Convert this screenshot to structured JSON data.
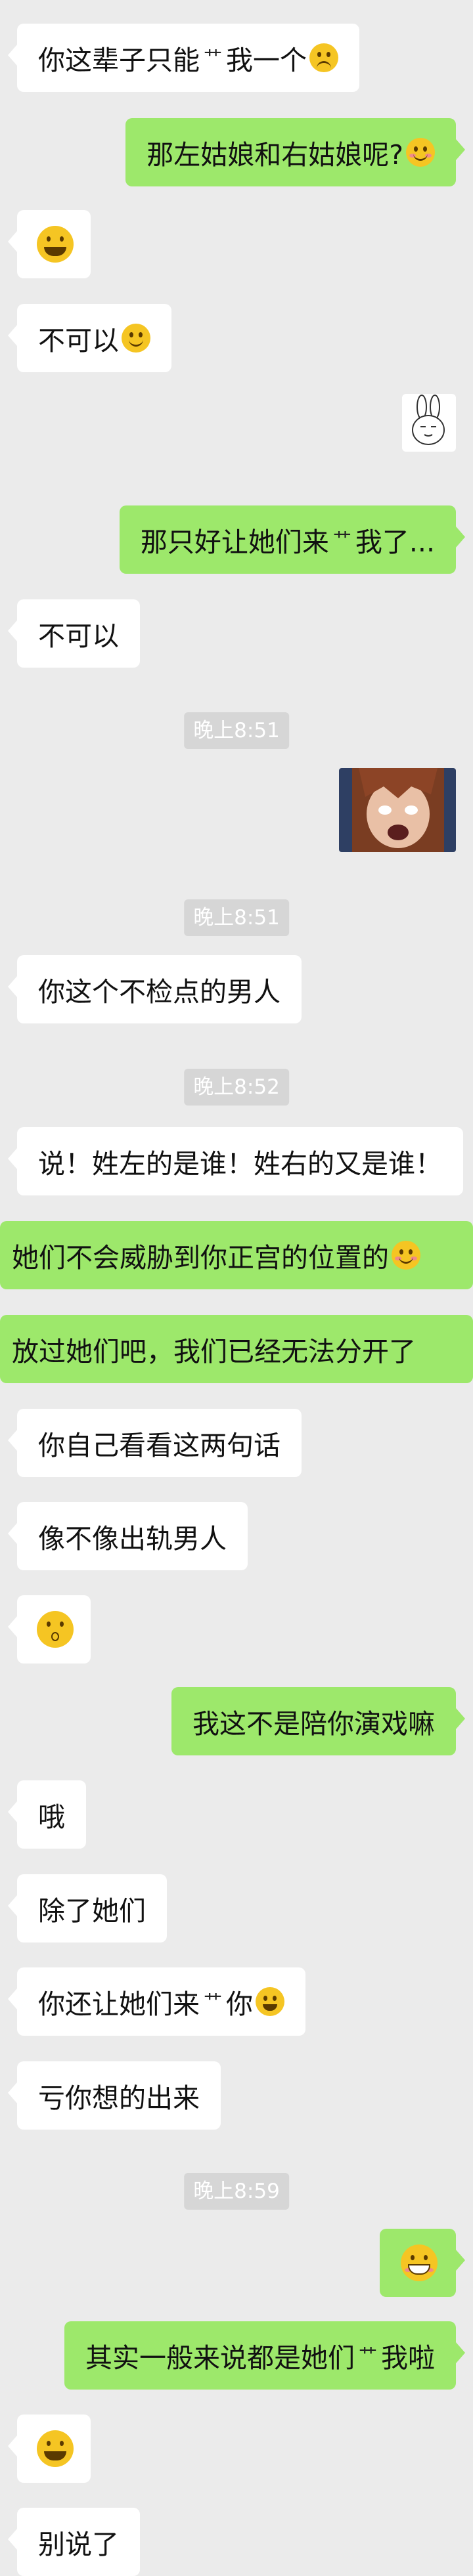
{
  "messages": [
    {
      "id": "m1",
      "side": "left",
      "text": "你这辈子只能",
      "kiss": "艹",
      "after": "我一个",
      "emoji": "confused-face-icon"
    },
    {
      "id": "m2",
      "side": "right",
      "text": "那左姑娘和右姑娘呢?",
      "emoji": "embarrassed-face-icon"
    },
    {
      "id": "m3",
      "side": "left",
      "text": "",
      "emoji": "laughing-tears-face-icon"
    },
    {
      "id": "m4",
      "side": "left",
      "text": "不可以",
      "emoji": "smiling-face-icon"
    },
    {
      "id": "m5",
      "side": "right",
      "sticker": "bunny-sticker-icon"
    },
    {
      "id": "m6",
      "side": "right",
      "text": "那只好让她们来",
      "kiss": "艹",
      "after": "我了..."
    },
    {
      "id": "m7",
      "side": "left",
      "text": "不可以"
    },
    {
      "id": "t1",
      "time": "晚上8:51"
    },
    {
      "id": "m8",
      "side": "right",
      "sticker": "anime-girl-image"
    },
    {
      "id": "t2",
      "time": "晚上8:51"
    },
    {
      "id": "m9",
      "side": "left",
      "text": "你这个不检点的男人"
    },
    {
      "id": "t3",
      "time": "晚上8:52"
    },
    {
      "id": "m10",
      "side": "left",
      "text": "说！姓左的是谁！姓右的又是谁！"
    },
    {
      "id": "m11",
      "side": "right",
      "text": "她们不会威胁到你正宫的位置的",
      "emoji": "embarrassed-face-icon"
    },
    {
      "id": "m12",
      "side": "right",
      "text": "放过她们吧，我们已经无法分开了"
    },
    {
      "id": "m13",
      "side": "left",
      "text": "你自己看看这两句话"
    },
    {
      "id": "m14",
      "side": "left",
      "text": "像不像出轨男人"
    },
    {
      "id": "m15",
      "side": "left",
      "text": "",
      "emoji": "shocked-face-icon"
    },
    {
      "id": "m16",
      "side": "right",
      "text": "我这不是陪你演戏嘛"
    },
    {
      "id": "m17",
      "side": "left",
      "text": "哦"
    },
    {
      "id": "m18",
      "side": "left",
      "text": "除了她们"
    },
    {
      "id": "m19",
      "side": "left",
      "text": "你还让她们来",
      "kiss": "艹",
      "after": "你",
      "emoji": "laughing-tears-face-icon"
    },
    {
      "id": "m20",
      "side": "left",
      "text": "亏你想的出来"
    },
    {
      "id": "t4",
      "time": "晚上8:59"
    },
    {
      "id": "m21",
      "side": "right",
      "text": "",
      "emoji": "grinning-blush-face-icon"
    },
    {
      "id": "m22",
      "side": "right",
      "text": "其实一般来说都是她们",
      "kiss": "艹",
      "after": "我啦"
    },
    {
      "id": "m23",
      "side": "left",
      "text": "",
      "emoji": "laughing-tears-face-icon"
    },
    {
      "id": "m24",
      "side": "left",
      "text": "别说了"
    }
  ],
  "colors": {
    "background": "#ebebeb",
    "sent_bubble": "#9de86b",
    "received_bubble": "#ffffff",
    "timestamp_bg": "#d6d6d6"
  }
}
